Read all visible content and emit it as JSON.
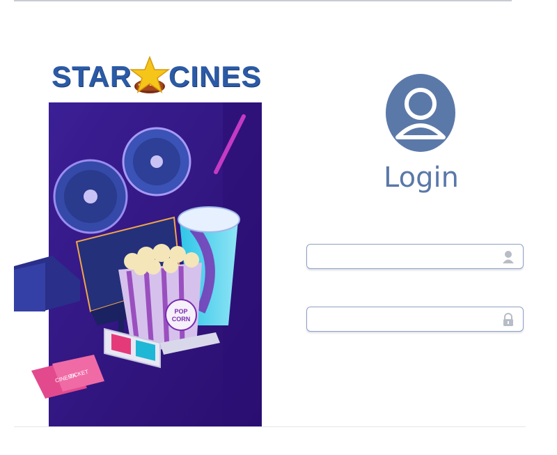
{
  "brand": {
    "left_word": "STAR",
    "right_word": "CINES",
    "brand_color": "#2b5aa6",
    "star_color": "#f6c51a"
  },
  "illustration": {
    "background": "#3a1a8a",
    "popcorn_text": "POP CORN",
    "ticket_text": "CINEMA TICKET"
  },
  "login": {
    "title": "Login",
    "accent": "#5a78a8",
    "avatar_icon": "user-avatar-icon",
    "username_field": {
      "value": "",
      "placeholder": "",
      "icon": "user-icon"
    },
    "password_field": {
      "value": "",
      "placeholder": "",
      "icon": "lock-icon"
    }
  }
}
